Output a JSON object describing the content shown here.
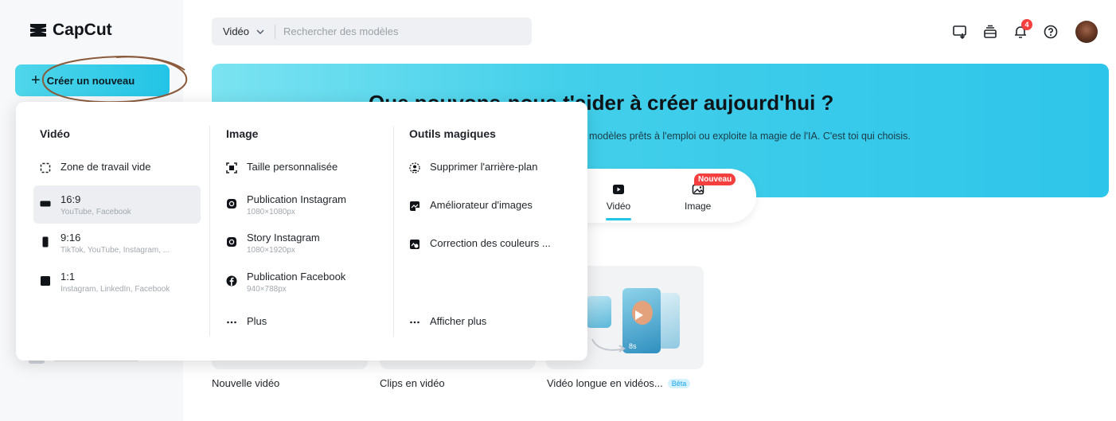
{
  "app": {
    "logo_text": "CapCut",
    "create_button_label": "Créer un nouveau",
    "create_button_icon": "plus-icon"
  },
  "search": {
    "type_label": "Vidéo",
    "placeholder": "Rechercher des modèles"
  },
  "header_icons": [
    "screen-record-icon",
    "layers-icon",
    "bell-icon",
    "help-icon"
  ],
  "notification_count": "4",
  "banner": {
    "title": "Que pouvons-nous t'aider à créer aujourd'hui ?",
    "subtitle": "modèles prêts à l'emploi ou exploite la magie de l'IA. C'est toi qui choisis."
  },
  "tabs": [
    {
      "label": "Vidéo",
      "icon": "play-icon",
      "active": true
    },
    {
      "label": "Image",
      "icon": "image-icon",
      "badge": "Nouveau"
    }
  ],
  "cards": [
    {
      "label": "Nouvelle vidéo"
    },
    {
      "label": "Clips en vidéo"
    },
    {
      "label": "Vidéo longue en vidéos...",
      "badge": "Bêta",
      "thumb_duration": "8s"
    }
  ],
  "dropdown": {
    "video": {
      "title": "Vidéo",
      "items": [
        {
          "label": "Zone de travail vide",
          "sub": "",
          "icon": "dashed-frame-icon"
        },
        {
          "label": "16:9",
          "sub": "YouTube, Facebook",
          "icon": "landscape-icon",
          "selected": true
        },
        {
          "label": "9:16",
          "sub": "TikTok, YouTube, Instagram, ...",
          "icon": "portrait-icon"
        },
        {
          "label": "1:1",
          "sub": "Instagram, LinkedIn, Facebook",
          "icon": "square-icon"
        }
      ]
    },
    "image": {
      "title": "Image",
      "items": [
        {
          "label": "Taille personnalisée",
          "sub": "",
          "icon": "custom-size-icon"
        },
        {
          "label": "Publication Instagram",
          "sub": "1080×1080px",
          "icon": "instagram-icon"
        },
        {
          "label": "Story Instagram",
          "sub": "1080×1920px",
          "icon": "instagram-icon"
        },
        {
          "label": "Publication Facebook",
          "sub": "940×788px",
          "icon": "facebook-icon"
        },
        {
          "label": "Plus",
          "sub": "",
          "icon": "more-icon"
        }
      ]
    },
    "magic": {
      "title": "Outils magiques",
      "items": [
        {
          "label": "Supprimer l'arrière-plan",
          "icon": "remove-bg-icon"
        },
        {
          "label": "Améliorateur d'images",
          "icon": "enhance-4k-icon"
        },
        {
          "label": "Correction des couleurs ...",
          "icon": "color-correct-icon"
        },
        {
          "label": "Afficher plus",
          "icon": "more-icon"
        }
      ]
    }
  },
  "colors": {
    "accent": "#22c4e6",
    "banner_start": "#7be3f1",
    "badge_red": "#f53f3f",
    "sidebar_bg": "#f7f8fa"
  }
}
